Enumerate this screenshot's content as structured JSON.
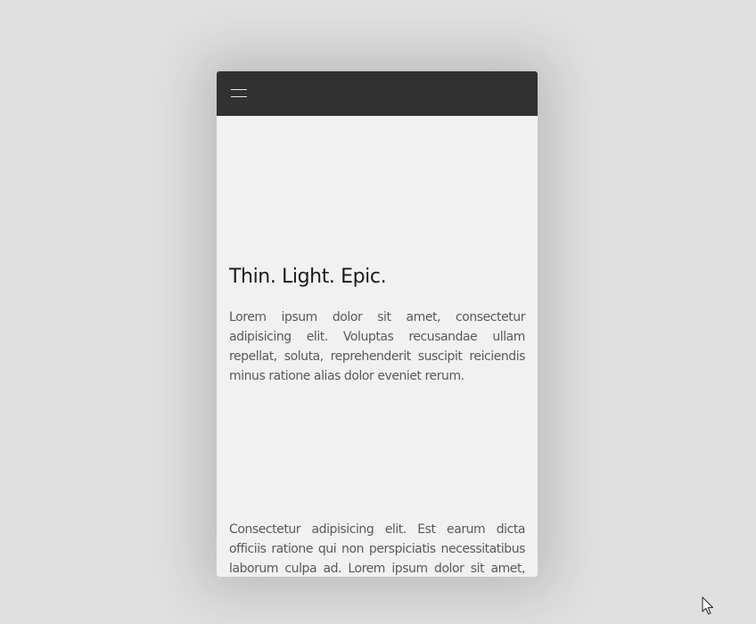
{
  "header": {
    "menu_icon": "hamburger-menu-icon",
    "background_color": "#313131"
  },
  "main": {
    "headline": "Thin. Light. Epic.",
    "paragraph_1": "Lorem ipsum dolor sit amet, consectetur adipisicing elit. Voluptas recusandae ullam repellat, soluta, reprehenderit suscipit reiciendis minus ratione alias dolor eveniet rerum.",
    "paragraph_2": "Consectetur adipisicing elit. Est earum dicta officiis ratione qui non perspiciatis necessitatibus laborum culpa ad. Lorem ipsum dolor sit amet, consectetur adipisicing elit."
  },
  "colors": {
    "page_background": "#e0e0e0",
    "card_background": "#f1f1f1",
    "headline_text": "#1a1a1a",
    "body_text": "#5a5a5a"
  },
  "pointer": {
    "icon": "mouse-cursor-icon"
  }
}
